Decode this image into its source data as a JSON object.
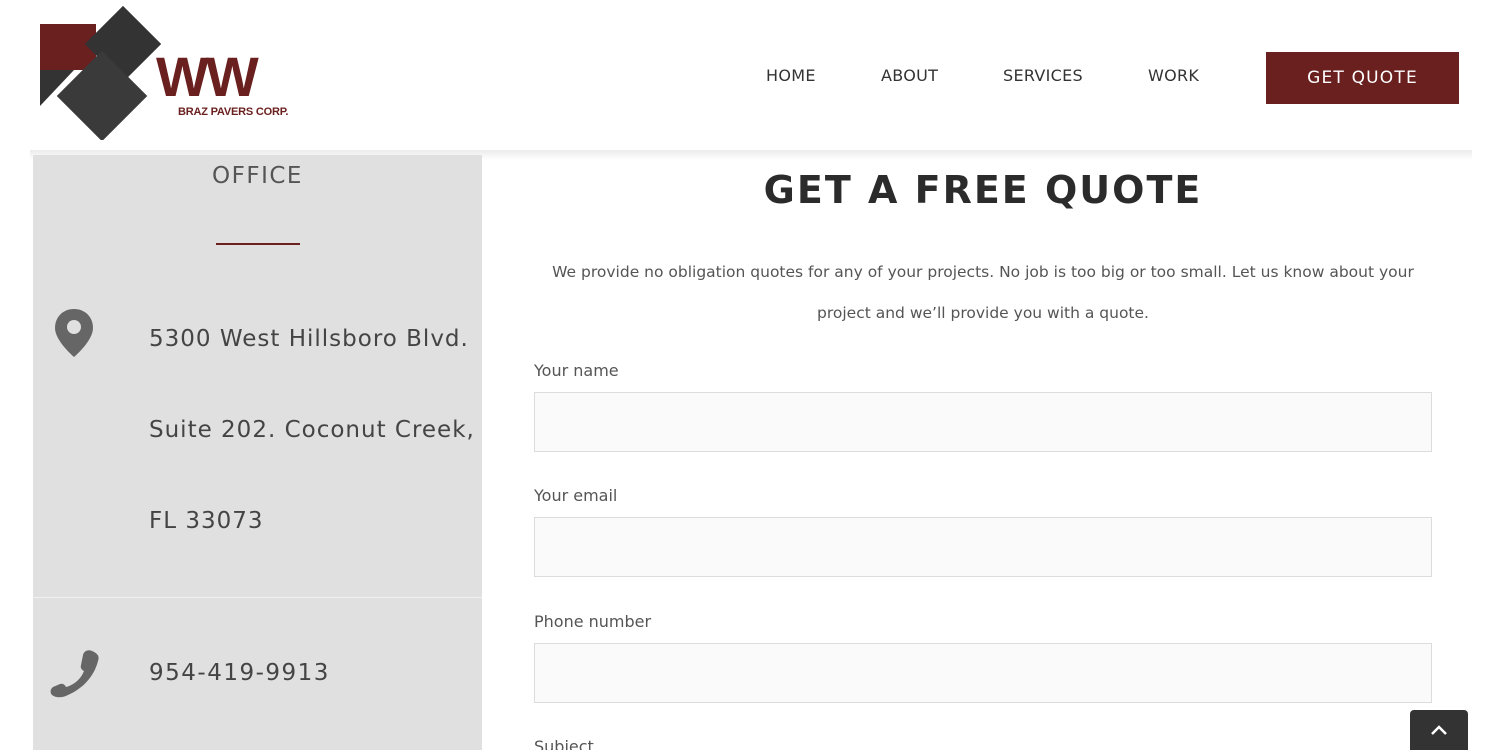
{
  "brand": {
    "logo_initials": "WW",
    "logo_text": "BRAZ PAVERS CORP.",
    "accent_color": "#6b2020"
  },
  "nav": {
    "items": [
      {
        "label": "HOME"
      },
      {
        "label": "ABOUT"
      },
      {
        "label": "SERVICES"
      },
      {
        "label": "WORK"
      }
    ],
    "cta_label": "GET QUOTE"
  },
  "office": {
    "title": "OFFICE",
    "address_lines": [
      "5300 West Hillsboro Blvd.",
      "Suite 202. Coconut Creek,",
      "FL 33073"
    ],
    "phone": "954-419-9913",
    "icons": {
      "address": "map-pin-icon",
      "phone": "phone-icon"
    }
  },
  "form": {
    "title": "GET A FREE QUOTE",
    "intro": "We provide no obligation quotes for any of your projects.  No job is too big or too small.  Let us know about your project and we’ll provide you with a quote.",
    "fields": {
      "name_label": "Your name",
      "name_value": "",
      "email_label": "Your email",
      "email_value": "",
      "phone_label": "Phone number",
      "phone_value": "",
      "subject_label": "Subject"
    }
  },
  "scroll_top_icon": "chevron-up-icon"
}
